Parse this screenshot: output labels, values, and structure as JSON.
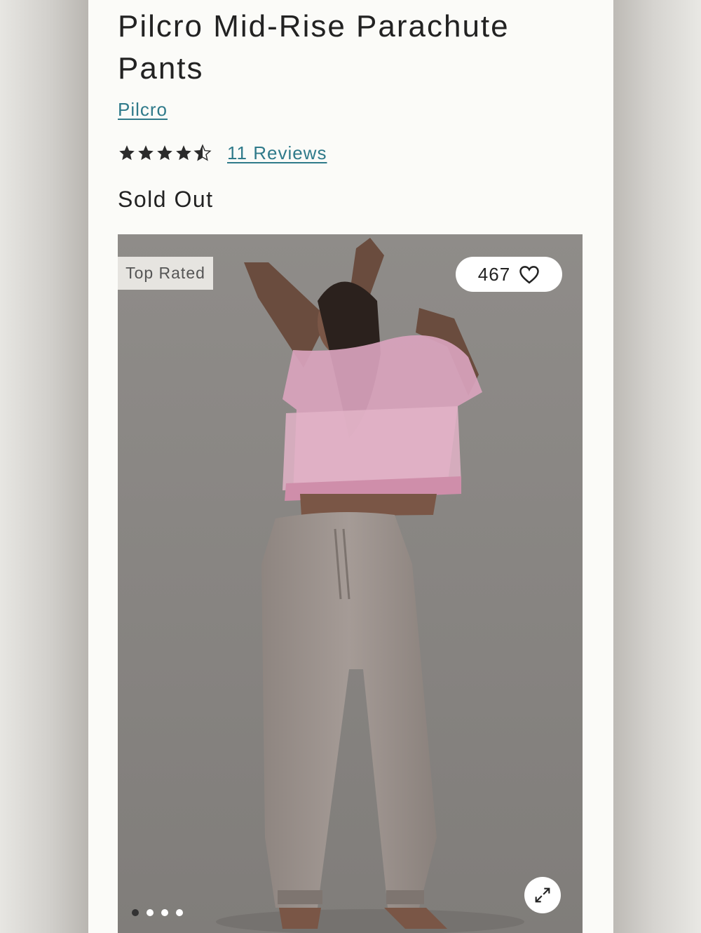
{
  "product": {
    "title": "Pilcro Mid-Rise Parachute Pants",
    "brand": "Pilcro",
    "rating": 4.5,
    "rating_max": 5,
    "reviews_label": "11 Reviews",
    "status": "Sold Out"
  },
  "gallery": {
    "badge": "Top Rated",
    "favorites_count": "467",
    "favorite_icon": "heart-icon",
    "expand_icon": "expand-icon",
    "image_count": 4,
    "current_image": 1
  },
  "colors": {
    "link": "#2f7a8a",
    "text": "#222222",
    "page_bg": "#fbfbf8",
    "photo_bg": "#8a8784"
  }
}
